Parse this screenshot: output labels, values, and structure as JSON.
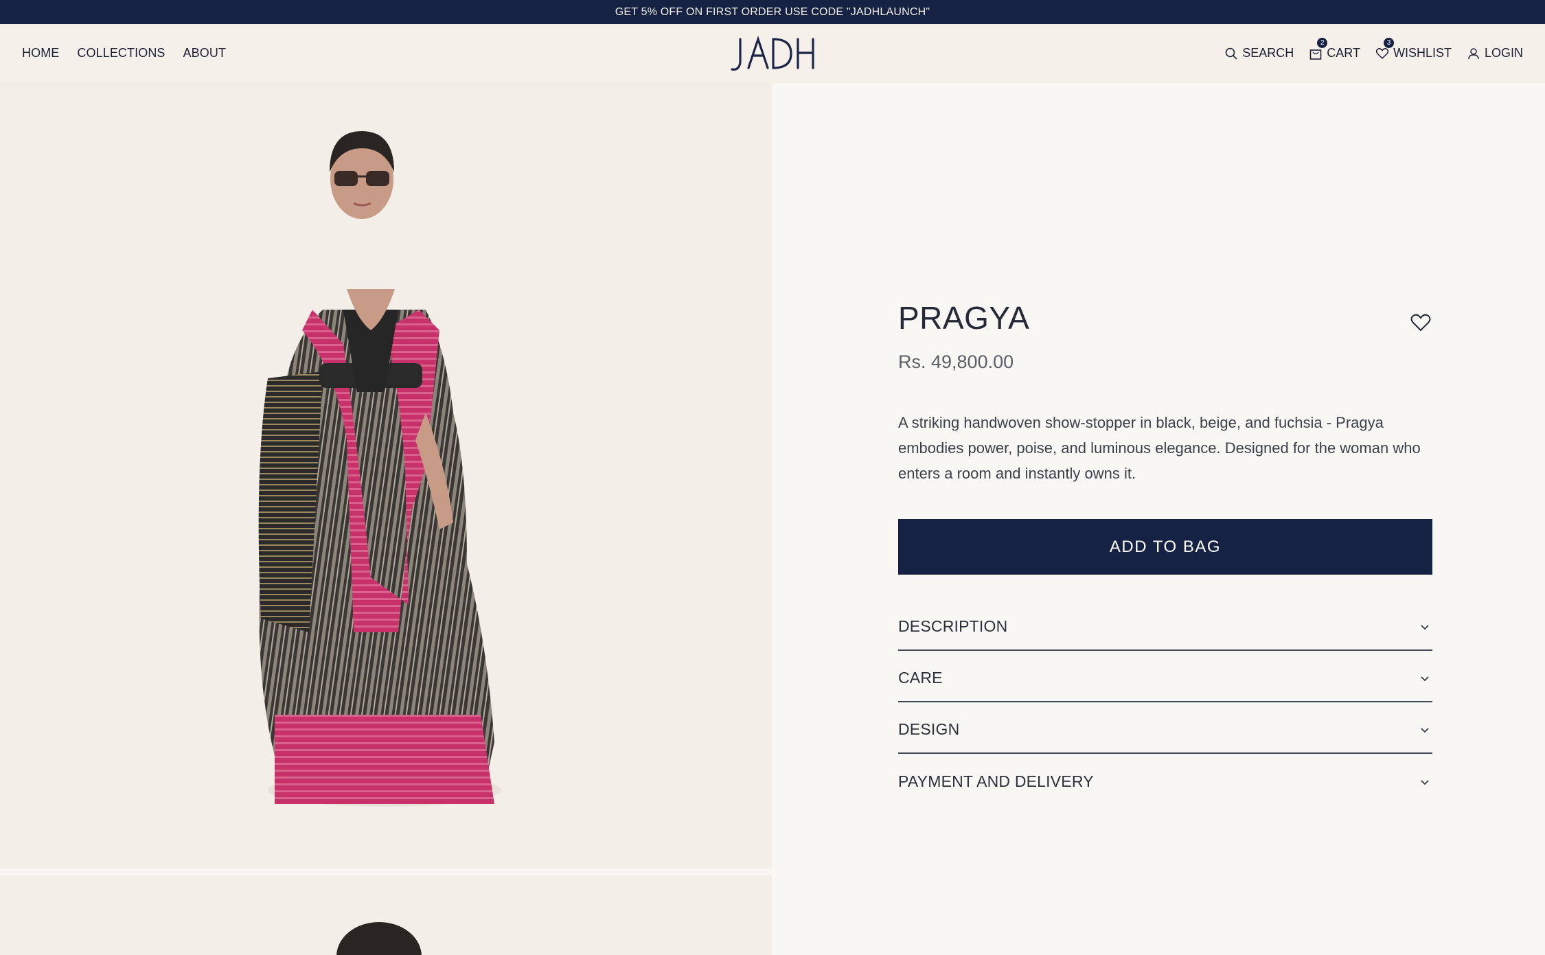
{
  "announcement": "GET 5% OFF ON FIRST ORDER USE CODE \"JADHLAUNCH\"",
  "header": {
    "nav_left": [
      "HOME",
      "COLLECTIONS",
      "ABOUT"
    ],
    "logo_text": "JADH",
    "search_label": "SEARCH",
    "cart_label": "CART",
    "cart_count": "2",
    "wishlist_label": "WISHLIST",
    "wishlist_count": "3",
    "login_label": "LOGIN"
  },
  "product": {
    "title": "PRAGYA",
    "price": "Rs. 49,800.00",
    "description": "A striking handwoven show-stopper in black, beige, and fuchsia - Pragya embodies power, poise, and luminous elegance. Designed for the woman who enters a room and instantly owns it.",
    "add_to_bag": "ADD TO BAG",
    "accordion": [
      "DESCRIPTION",
      "CARE",
      "DESIGN",
      "PAYMENT AND DELIVERY"
    ]
  },
  "colors": {
    "navy": "#152243",
    "cream": "#f5f1ea",
    "fuchsia": "#c8326a"
  },
  "icons": [
    "search-icon",
    "bag-icon",
    "heart-icon",
    "user-icon",
    "chevron-down-icon"
  ]
}
